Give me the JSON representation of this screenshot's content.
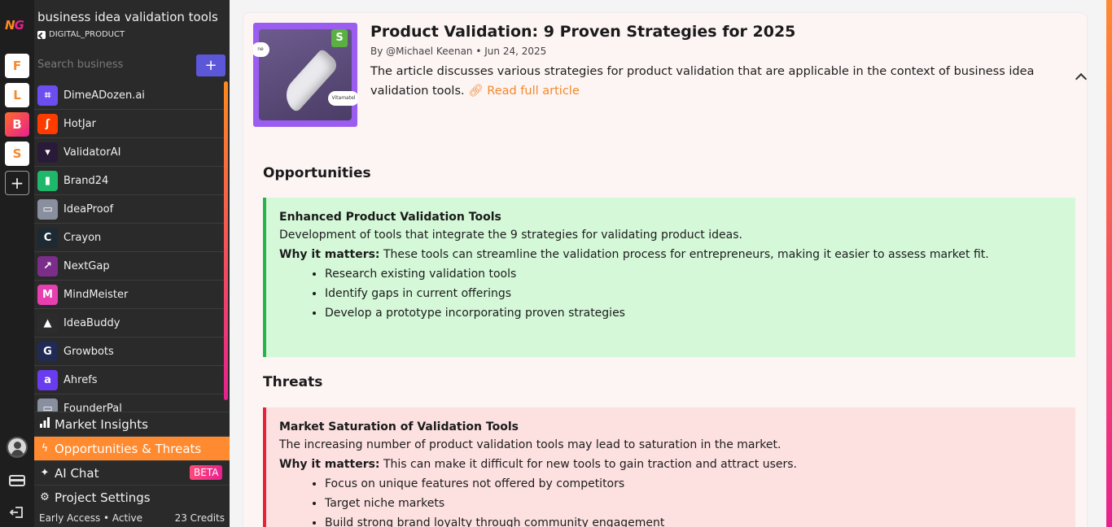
{
  "rail": {
    "logo": "NG",
    "projects": [
      {
        "letter": "F",
        "state": "light"
      },
      {
        "letter": "L",
        "state": "light"
      },
      {
        "letter": "B",
        "state": "active"
      },
      {
        "letter": "S",
        "state": "light"
      }
    ],
    "add_label": "+"
  },
  "sidebar": {
    "title": "business idea validation tools",
    "type": "DIGITAL_PRODUCT",
    "search_placeholder": "Search business",
    "add_label": "+",
    "items": [
      {
        "label": "DimeADozen.ai",
        "icon": "dimeadozen-logo",
        "color": "#6c4ef0",
        "glyph": "⌗"
      },
      {
        "label": "HotJar",
        "icon": "hotjar-logo",
        "color": "#ff3c00",
        "glyph": "ʃ"
      },
      {
        "label": "ValidatorAI",
        "icon": "validatorai-logo",
        "color": "#2a1a3a",
        "glyph": "▾"
      },
      {
        "label": "Brand24",
        "icon": "brand24-logo",
        "color": "#1fb86a",
        "glyph": "▮"
      },
      {
        "label": "IdeaProof",
        "icon": "ideaproof-logo",
        "color": "#8a8fa0",
        "glyph": "▭"
      },
      {
        "label": "Crayon",
        "icon": "crayon-logo",
        "color": "#1e2a33",
        "glyph": "C"
      },
      {
        "label": "NextGap",
        "icon": "nextgap-logo",
        "color": "#7a2e8a",
        "glyph": "↗"
      },
      {
        "label": "MindMeister",
        "icon": "mindmeister-logo",
        "color": "#e83fb0",
        "glyph": "M"
      },
      {
        "label": "IdeaBuddy",
        "icon": "ideabuddy-logo",
        "color": "#2c2c2c",
        "glyph": "▲"
      },
      {
        "label": "Growbots",
        "icon": "growbots-logo",
        "color": "#1f2a55",
        "glyph": "G"
      },
      {
        "label": "Ahrefs",
        "icon": "ahrefs-logo",
        "color": "#6a3cf0",
        "glyph": "a"
      },
      {
        "label": "FounderPal",
        "icon": "founderpal-logo",
        "color": "#8a8fa0",
        "glyph": "▭"
      }
    ],
    "menu": [
      {
        "label": "Market Insights",
        "icon": "bar-chart-icon",
        "glyph": "▟",
        "selected": false
      },
      {
        "label": "Opportunities & Threats",
        "icon": "lightning-icon",
        "glyph": "ϟ",
        "selected": true
      },
      {
        "label": "AI Chat",
        "icon": "sparkle-icon",
        "glyph": "✦",
        "selected": false,
        "badge": "BETA"
      },
      {
        "label": "Project Settings",
        "icon": "gear-icon",
        "glyph": "⚙",
        "selected": false
      }
    ],
    "status": {
      "plan": "Early Access • Active",
      "credits": "23 Credits"
    }
  },
  "article": {
    "title": "Product Validation: 9 Proven Strategies for 2025",
    "author": "By @Michael Keenan",
    "date": "Jun 24, 2025",
    "description": "The article discusses various strategies for product validation that are applicable in the context of business idea validation tools.",
    "link_label": "Read full article",
    "thumb_left_pill": "ne",
    "thumb_right_pill": "Vitamatel"
  },
  "opportunities": {
    "heading": "Opportunities",
    "items": [
      {
        "title": "Enhanced Product Validation Tools",
        "description": "Development of tools that integrate the 9 strategies for validating product ideas.",
        "why_label": "Why it matters:",
        "why": "These tools can streamline the validation process for entrepreneurs, making it easier to assess market fit.",
        "steps": [
          "Research existing validation tools",
          "Identify gaps in current offerings",
          "Develop a prototype incorporating proven strategies"
        ]
      }
    ]
  },
  "threats": {
    "heading": "Threats",
    "items": [
      {
        "title": "Market Saturation of Validation Tools",
        "description": "The increasing number of product validation tools may lead to saturation in the market.",
        "why_label": "Why it matters:",
        "why": "This can make it difficult for new tools to gain traction and attract users.",
        "steps": [
          "Focus on unique features not offered by competitors",
          "Target niche markets",
          "Build strong brand loyalty through community engagement"
        ]
      }
    ]
  },
  "colors": {
    "accent": "#ff8a30",
    "brand_pink": "#e8208f",
    "add_button": "#5b57d8",
    "opportunity": "#23b34a",
    "threat": "#e8203a"
  }
}
